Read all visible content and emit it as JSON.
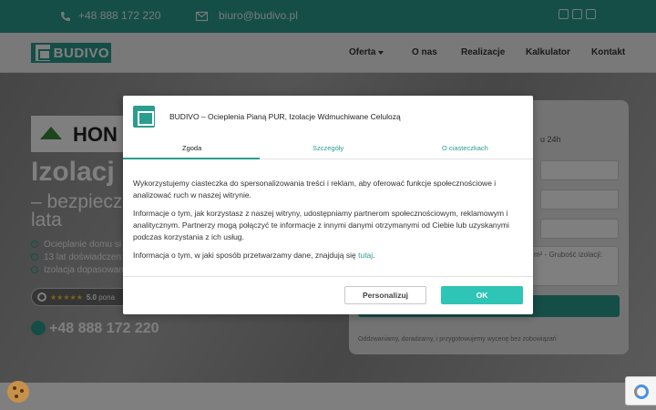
{
  "topbar": {
    "phone": "+48 888 172 220",
    "email": "biuro@budivo.pl",
    "phone_icon": "phone-icon",
    "mail_icon": "mail-icon",
    "social_icons": [
      "facebook-icon",
      "instagram-icon",
      "tiktok-icon"
    ]
  },
  "nav": {
    "logo_text": "BUDIVO",
    "items": [
      {
        "label": "Oferta"
      },
      {
        "label": "O nas"
      },
      {
        "label": "Realizacje"
      },
      {
        "label": "Kalkulator"
      },
      {
        "label": "Kontakt"
      }
    ]
  },
  "hero": {
    "partner_logo_text": "HON",
    "title": "Izolacj",
    "subtitle_line1": "– bezpiecz",
    "subtitle_line2": "lata",
    "bullets": [
      "Ocieplanie domu si",
      "13 lat doświadczen",
      "Izolacja dopasowan"
    ],
    "rating_score": "5.0",
    "rating_suffix": "pona",
    "phone": "+48 888 172 220"
  },
  "form": {
    "text": "u 24h",
    "textarea_placeholder": "m² - Grubość izolacji:",
    "note": "Oddzwaniamy, doradzamy, i przygotowujemy wycenę bez zobowiązań"
  },
  "modal": {
    "title": "BUDIVO – Ocieplenia Pianą PUR, Izolacje Wdmuchiwane Celulozą",
    "tabs": [
      "Zgoda",
      "Szczegóły",
      "O ciasteczkach"
    ],
    "active_tab": "Zgoda",
    "paragraph1": "Wykorzystujemy ciasteczka do spersonalizowania treści i reklam, aby oferować funkcje społecznościowe i analizować ruch w naszej witrynie.",
    "paragraph2": "Informacje o tym, jak korzystasz z naszej witryny, udostępniamy partnerom społecznościowym, reklamowym i analitycznym. Partnerzy mogą połączyć te informacje z innymi danymi otrzymanymi od Ciebie lub uzyskanymi podczas korzystania z ich usług.",
    "paragraph3_prefix": "Informacja o tym, w jaki sposób przetwarzamy dane, znajdują się",
    "paragraph3_link": "tutaj",
    "paragraph3_suffix": ".",
    "personalize_label": "Personalizuj",
    "ok_label": "OK"
  },
  "colors": {
    "accent": "#2a9d8f",
    "ok_button": "#2ec4b6"
  }
}
